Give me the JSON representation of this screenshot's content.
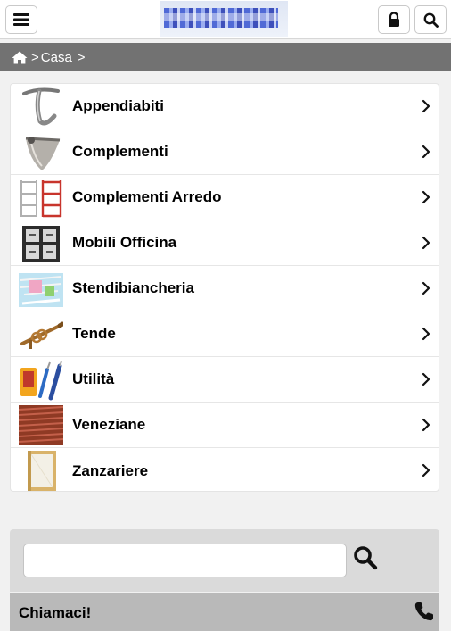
{
  "header": {
    "menu_icon": "hamburger-icon",
    "lock_icon": "lock-icon",
    "search_icon": "search-icon",
    "logo_alt": "logo"
  },
  "breadcrumb": {
    "home_icon": "home-icon",
    "separator": ">",
    "items": [
      "Casa"
    ]
  },
  "categories": [
    {
      "label": "Appendiabiti",
      "icon": "hook-thumbnail"
    },
    {
      "label": "Complementi",
      "icon": "shelf-bracket-thumbnail"
    },
    {
      "label": "Complementi Arredo",
      "icon": "shelving-unit-thumbnail"
    },
    {
      "label": "Mobili Officina",
      "icon": "workshop-cabinet-thumbnail"
    },
    {
      "label": "Stendibiancheria",
      "icon": "drying-rack-thumbnail"
    },
    {
      "label": "Tende",
      "icon": "curtain-rod-thumbnail"
    },
    {
      "label": "Utilità",
      "icon": "utility-tools-thumbnail"
    },
    {
      "label": "Veneziane",
      "icon": "venetian-blind-thumbnail"
    },
    {
      "label": "Zanzariere",
      "icon": "mosquito-net-thumbnail"
    }
  ],
  "search": {
    "value": "",
    "placeholder": "",
    "button_icon": "search-icon"
  },
  "call": {
    "label": "Chiamaci!",
    "icon": "phone-icon"
  }
}
